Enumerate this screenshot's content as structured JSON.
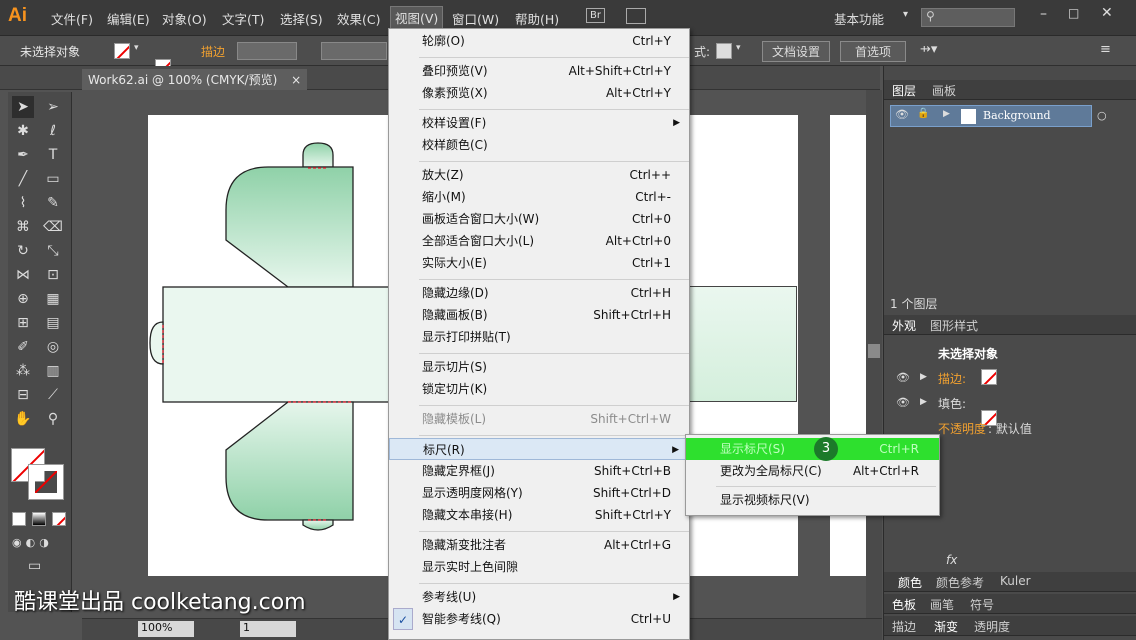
{
  "app": {
    "logo": "Ai"
  },
  "menubar": {
    "items": [
      "文件(F)",
      "编辑(E)",
      "对象(O)",
      "文字(T)",
      "选择(S)",
      "效果(C)",
      "视图(V)",
      "窗口(W)",
      "帮助(H)"
    ],
    "br_label": "Br",
    "workspace": "基本功能",
    "workspace_arrow": "▾"
  },
  "controlbar": {
    "selection": "未选择对象",
    "stroke_label": "描边",
    "style_label": "式:",
    "doc_settings": "文档设置",
    "preferences": "首选项"
  },
  "document": {
    "tab_title": "Work62.ai @ 100% (CMYK/预览)",
    "close": "×"
  },
  "status": {
    "zoom": "100%",
    "page": "1"
  },
  "layers_panel": {
    "tabs": [
      "图层",
      "画板"
    ],
    "layer_name": "Background",
    "layer_count": "1 个图层"
  },
  "appearance_panel": {
    "tabs": [
      "外观",
      "图形样式"
    ],
    "title": "未选择对象",
    "stroke_label": "描边:",
    "fill_label": "填色:",
    "opacity_label": "不透明度",
    "opacity_value": ": 默认值",
    "fx_label": "fx"
  },
  "bottom_panels": {
    "row1": [
      "颜色",
      "颜色参考",
      "Kuler"
    ],
    "row2": [
      "色板",
      "画笔",
      "符号"
    ],
    "row3": [
      "描边",
      "渐变",
      "透明度"
    ]
  },
  "view_menu": {
    "items": [
      {
        "label": "轮廓(O)",
        "shortcut": "Ctrl+Y"
      },
      {
        "label": "叠印预览(V)",
        "shortcut": "Alt+Shift+Ctrl+Y"
      },
      {
        "label": "像素预览(X)",
        "shortcut": "Alt+Ctrl+Y"
      },
      {
        "label": "校样设置(F)",
        "shortcut": ""
      },
      {
        "label": "校样颜色(C)",
        "shortcut": ""
      },
      {
        "label": "放大(Z)",
        "shortcut": "Ctrl++"
      },
      {
        "label": "缩小(M)",
        "shortcut": "Ctrl+-"
      },
      {
        "label": "画板适合窗口大小(W)",
        "shortcut": "Ctrl+0"
      },
      {
        "label": "全部适合窗口大小(L)",
        "shortcut": "Alt+Ctrl+0"
      },
      {
        "label": "实际大小(E)",
        "shortcut": "Ctrl+1"
      },
      {
        "label": "隐藏边缘(D)",
        "shortcut": "Ctrl+H"
      },
      {
        "label": "隐藏画板(B)",
        "shortcut": "Shift+Ctrl+H"
      },
      {
        "label": "显示打印拼贴(T)",
        "shortcut": ""
      },
      {
        "label": "显示切片(S)",
        "shortcut": ""
      },
      {
        "label": "锁定切片(K)",
        "shortcut": ""
      },
      {
        "label": "隐藏模板(L)",
        "shortcut": "Shift+Ctrl+W"
      },
      {
        "label": "标尺(R)",
        "shortcut": ""
      },
      {
        "label": "隐藏定界框(J)",
        "shortcut": "Shift+Ctrl+B"
      },
      {
        "label": "显示透明度网格(Y)",
        "shortcut": "Shift+Ctrl+D"
      },
      {
        "label": "隐藏文本串接(H)",
        "shortcut": "Shift+Ctrl+Y"
      },
      {
        "label": "隐藏渐变批注者",
        "shortcut": "Alt+Ctrl+G"
      },
      {
        "label": "显示实时上色间隙",
        "shortcut": ""
      },
      {
        "label": "参考线(U)",
        "shortcut": ""
      },
      {
        "label": "智能参考线(Q)",
        "shortcut": "Ctrl+U"
      }
    ],
    "check": "✓",
    "arrow": "▶"
  },
  "ruler_submenu": {
    "items": [
      {
        "label": "显示标尺(S)",
        "shortcut": "Ctrl+R"
      },
      {
        "label": "更改为全局标尺(C)",
        "shortcut": "Alt+Ctrl+R"
      },
      {
        "label": "显示视频标尺(V)",
        "shortcut": ""
      }
    ],
    "step_badge": "3"
  },
  "watermark": "酷课堂出品 coolketang.com",
  "colors": {
    "highlight": "#2ee02e",
    "badge": "#1c7a2a",
    "shape_fill": "#a9dcbc"
  }
}
